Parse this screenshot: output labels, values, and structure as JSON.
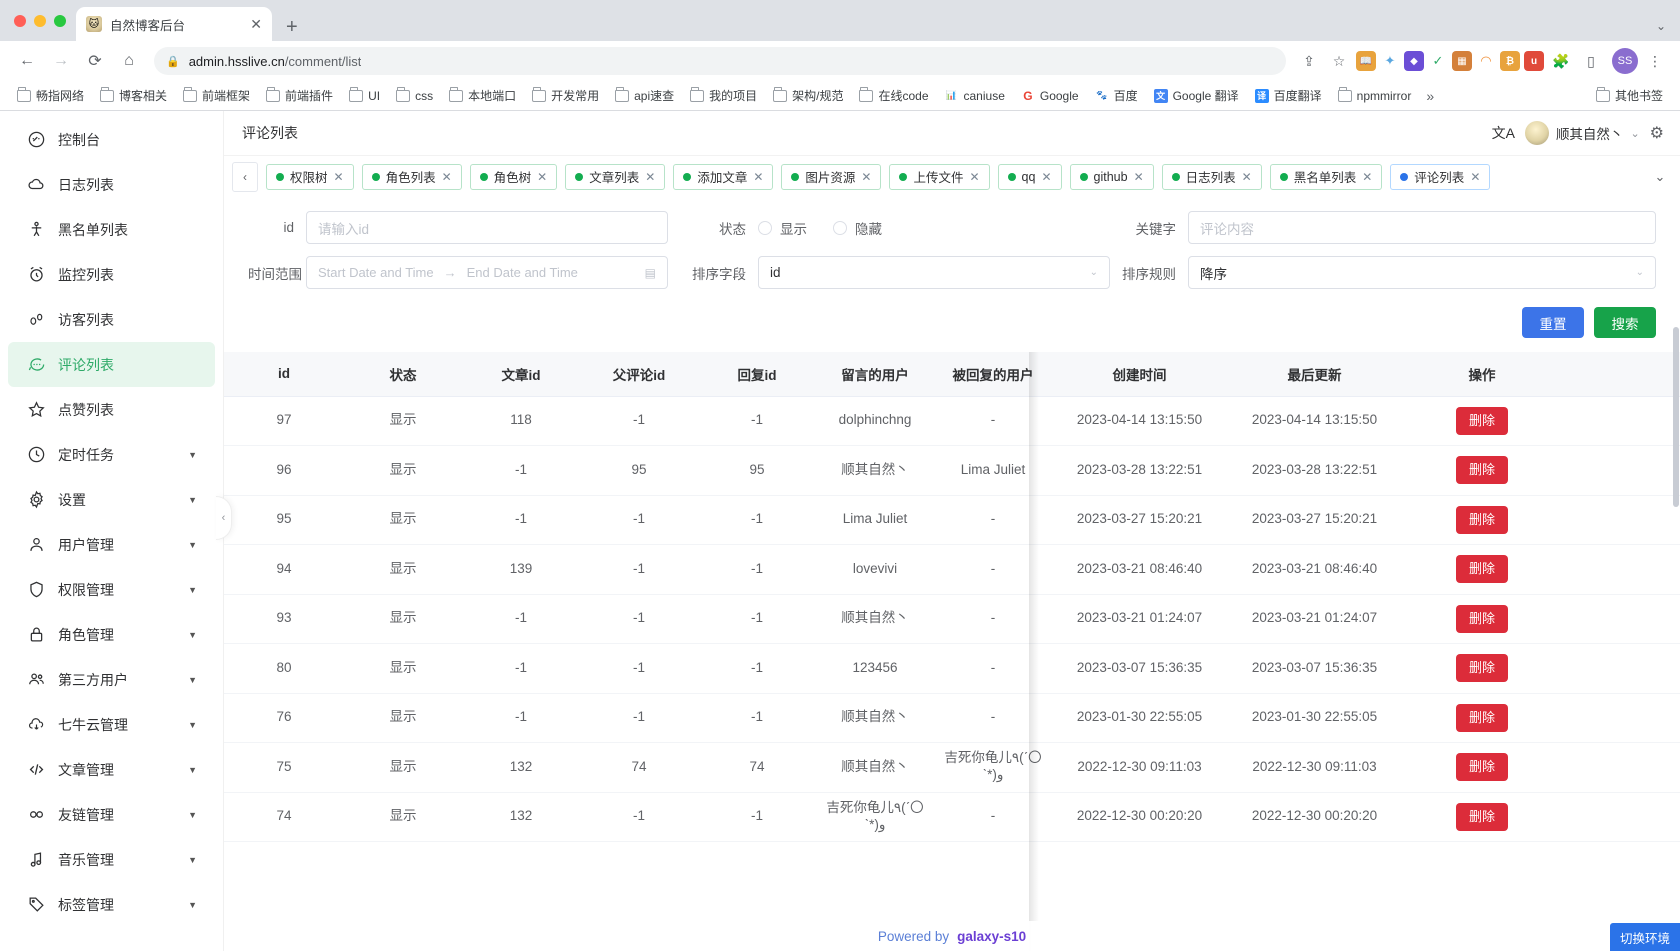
{
  "browser": {
    "tab": {
      "title": "自然博客后台",
      "close_label": "✕"
    },
    "new_tab_label": "+",
    "tabstrip_more": "⌄",
    "nav": {
      "back": "←",
      "forward": "→",
      "reload": "⟳",
      "home": "⌂"
    },
    "url": {
      "lock": "🔒",
      "host": "admin.hsslive.cn",
      "path": "/comment/list"
    },
    "omni_icons": [
      {
        "name": "share-icon",
        "glyph": "⇪"
      },
      {
        "name": "bookmark-star-icon",
        "glyph": "☆"
      }
    ],
    "extensions": [
      {
        "name": "ext-reader",
        "glyph": "📖",
        "color": "#e8a33d"
      },
      {
        "name": "ext-star",
        "glyph": "✦",
        "color": "#5aa7e0"
      },
      {
        "name": "ext-diamond",
        "glyph": "◆",
        "color": "#6b4ed6"
      },
      {
        "name": "ext-check",
        "glyph": "✓",
        "color": "#4caf50"
      },
      {
        "name": "ext-grid",
        "glyph": "▦",
        "color": "#d4803a"
      },
      {
        "name": "ext-rainbow",
        "glyph": "◠",
        "color": "#f0913a"
      },
      {
        "name": "ext-coin",
        "glyph": "₿",
        "color": "#e8a33d"
      },
      {
        "name": "ext-badge",
        "glyph": "u",
        "color": "#e04a3a"
      },
      {
        "name": "ext-puzzle",
        "glyph": "🧩",
        "color": "#8a8f98"
      },
      {
        "name": "ext-panel",
        "glyph": "▯",
        "color": "#8a8f98"
      }
    ],
    "profile_initials": "SS",
    "menu_glyph": "⋮",
    "bookmarks": [
      {
        "label": "畅指网络",
        "icon": "folder"
      },
      {
        "label": "博客相关",
        "icon": "folder"
      },
      {
        "label": "前端框架",
        "icon": "folder"
      },
      {
        "label": "前端插件",
        "icon": "folder"
      },
      {
        "label": "UI",
        "icon": "folder"
      },
      {
        "label": "css",
        "icon": "folder"
      },
      {
        "label": "本地端口",
        "icon": "folder"
      },
      {
        "label": "开发常用",
        "icon": "folder"
      },
      {
        "label": "api速查",
        "icon": "folder"
      },
      {
        "label": "我的项目",
        "icon": "folder"
      },
      {
        "label": "架构/规范",
        "icon": "folder"
      },
      {
        "label": "在线code",
        "icon": "folder"
      },
      {
        "label": "caniuse",
        "icon": "fav",
        "glyph": "📊",
        "color": "#ffffff"
      },
      {
        "label": "Google",
        "icon": "fav",
        "glyph": "G",
        "color": "#ffffff"
      },
      {
        "label": "百度",
        "icon": "fav",
        "glyph": "🐾",
        "color": "#ffffff"
      },
      {
        "label": "Google 翻译",
        "icon": "fav",
        "glyph": "文",
        "color": "#4285f4"
      },
      {
        "label": "百度翻译",
        "icon": "fav",
        "glyph": "译",
        "color": "#2b8cff"
      },
      {
        "label": "npmmirror",
        "icon": "folder"
      }
    ],
    "bookmarks_overflow": "»",
    "other_bookmarks": {
      "label": "其他书签",
      "icon": "folder"
    }
  },
  "sidebar": {
    "items": [
      {
        "label": "控制台",
        "icon": "dashboard-icon",
        "expandable": false,
        "active": false
      },
      {
        "label": "日志列表",
        "icon": "cloud-icon",
        "expandable": false,
        "active": false
      },
      {
        "label": "黑名单列表",
        "icon": "person-icon",
        "expandable": false,
        "active": false
      },
      {
        "label": "监控列表",
        "icon": "alarm-icon",
        "expandable": false,
        "active": false
      },
      {
        "label": "访客列表",
        "icon": "footprint-icon",
        "expandable": false,
        "active": false
      },
      {
        "label": "评论列表",
        "icon": "comment-icon",
        "expandable": false,
        "active": true
      },
      {
        "label": "点赞列表",
        "icon": "star-icon",
        "expandable": false,
        "active": false
      },
      {
        "label": "定时任务",
        "icon": "clock-icon",
        "expandable": true,
        "active": false
      },
      {
        "label": "设置",
        "icon": "gear-icon",
        "expandable": true,
        "active": false
      },
      {
        "label": "用户管理",
        "icon": "user-icon",
        "expandable": true,
        "active": false
      },
      {
        "label": "权限管理",
        "icon": "shield-icon",
        "expandable": true,
        "active": false
      },
      {
        "label": "角色管理",
        "icon": "lock-icon",
        "expandable": true,
        "active": false
      },
      {
        "label": "第三方用户",
        "icon": "users-icon",
        "expandable": true,
        "active": false
      },
      {
        "label": "七牛云管理",
        "icon": "cloud-download-icon",
        "expandable": true,
        "active": false
      },
      {
        "label": "文章管理",
        "icon": "code-icon",
        "expandable": true,
        "active": false
      },
      {
        "label": "友链管理",
        "icon": "infinity-icon",
        "expandable": true,
        "active": false
      },
      {
        "label": "音乐管理",
        "icon": "music-icon",
        "expandable": true,
        "active": false
      },
      {
        "label": "标签管理",
        "icon": "tag-icon",
        "expandable": true,
        "active": false
      }
    ],
    "caret": "▼",
    "collapse_glyph": "‹"
  },
  "topbar": {
    "breadcrumb": "评论列表",
    "translate_icon": "文A",
    "username": "顺其自然丶",
    "user_caret": "⌄",
    "settings_icon": "⚙"
  },
  "tagbar": {
    "left_arrow": "‹",
    "dropdown": "⌄",
    "tags": [
      {
        "label": "权限树",
        "current": false,
        "close": "✕"
      },
      {
        "label": "角色列表",
        "current": false,
        "close": "✕"
      },
      {
        "label": "角色树",
        "current": false,
        "close": "✕"
      },
      {
        "label": "文章列表",
        "current": false,
        "close": "✕"
      },
      {
        "label": "添加文章",
        "current": false,
        "close": "✕"
      },
      {
        "label": "图片资源",
        "current": false,
        "close": "✕"
      },
      {
        "label": "上传文件",
        "current": false,
        "close": "✕"
      },
      {
        "label": "qq",
        "current": false,
        "close": "✕"
      },
      {
        "label": "github",
        "current": false,
        "close": "✕"
      },
      {
        "label": "日志列表",
        "current": false,
        "close": "✕"
      },
      {
        "label": "黑名单列表",
        "current": false,
        "close": "✕"
      },
      {
        "label": "评论列表",
        "current": true,
        "close": "✕"
      }
    ]
  },
  "filters": {
    "id": {
      "label": "id",
      "placeholder": "请输入id",
      "value": ""
    },
    "status": {
      "label": "状态",
      "options": [
        {
          "label": "显示",
          "checked": false
        },
        {
          "label": "隐藏",
          "checked": false
        }
      ]
    },
    "keyword": {
      "label": "关键字",
      "placeholder": "评论内容",
      "value": ""
    },
    "time_range": {
      "label": "时间范围",
      "start_placeholder": "Start Date and Time",
      "end_placeholder": "End Date and Time",
      "separator": "→",
      "calendar_icon": "▤"
    },
    "sort_field": {
      "label": "排序字段",
      "value": "id",
      "caret": "⌄"
    },
    "sort_rule": {
      "label": "排序规则",
      "value": "降序",
      "caret": "⌄"
    },
    "buttons": {
      "reset": "重置",
      "search": "搜索"
    }
  },
  "table": {
    "columns": [
      "id",
      "状态",
      "文章id",
      "父评论id",
      "回复id",
      "留言的用户",
      "被回复的用户",
      "创建时间",
      "最后更新",
      "操作"
    ],
    "delete_label": "删除",
    "rows": [
      {
        "id": "97",
        "status": "显示",
        "article_id": "118",
        "parent_id": "-1",
        "reply_id": "-1",
        "user": "dolphinchng",
        "replied_user": "-",
        "created": "2023-04-14 13:15:50",
        "updated": "2023-04-14 13:15:50"
      },
      {
        "id": "96",
        "status": "显示",
        "article_id": "-1",
        "parent_id": "95",
        "reply_id": "95",
        "user": "顺其自然丶",
        "replied_user": "Lima Juliet",
        "created": "2023-03-28 13:22:51",
        "updated": "2023-03-28 13:22:51"
      },
      {
        "id": "95",
        "status": "显示",
        "article_id": "-1",
        "parent_id": "-1",
        "reply_id": "-1",
        "user": "Lima Juliet",
        "replied_user": "-",
        "created": "2023-03-27 15:20:21",
        "updated": "2023-03-27 15:20:21"
      },
      {
        "id": "94",
        "status": "显示",
        "article_id": "139",
        "parent_id": "-1",
        "reply_id": "-1",
        "user": "lovevivi",
        "replied_user": "-",
        "created": "2023-03-21 08:46:40",
        "updated": "2023-03-21 08:46:40"
      },
      {
        "id": "93",
        "status": "显示",
        "article_id": "-1",
        "parent_id": "-1",
        "reply_id": "-1",
        "user": "顺其自然丶",
        "replied_user": "-",
        "created": "2023-03-21 01:24:07",
        "updated": "2023-03-21 01:24:07"
      },
      {
        "id": "80",
        "status": "显示",
        "article_id": "-1",
        "parent_id": "-1",
        "reply_id": "-1",
        "user": "123456",
        "replied_user": "-",
        "created": "2023-03-07 15:36:35",
        "updated": "2023-03-07 15:36:35"
      },
      {
        "id": "76",
        "status": "显示",
        "article_id": "-1",
        "parent_id": "-1",
        "reply_id": "-1",
        "user": "顺其自然丶",
        "replied_user": "-",
        "created": "2023-01-30 22:55:05",
        "updated": "2023-01-30 22:55:05"
      },
      {
        "id": "75",
        "status": "显示",
        "article_id": "132",
        "parent_id": "74",
        "reply_id": "74",
        "user": "顺其自然丶",
        "replied_user": "吉死你龟儿٩(ˊ〇ˋ*)و",
        "created": "2022-12-30 09:11:03",
        "updated": "2022-12-30 09:11:03"
      },
      {
        "id": "74",
        "status": "显示",
        "article_id": "132",
        "parent_id": "-1",
        "reply_id": "-1",
        "user": "吉死你龟儿٩(ˊ〇ˋ*)و",
        "replied_user": "-",
        "created": "2022-12-30 00:20:20",
        "updated": "2022-12-30 00:20:20"
      }
    ]
  },
  "footer": {
    "powered_prefix": "Powered by",
    "brand": "galaxy-s10"
  },
  "env_button": {
    "label": "切换环境"
  }
}
